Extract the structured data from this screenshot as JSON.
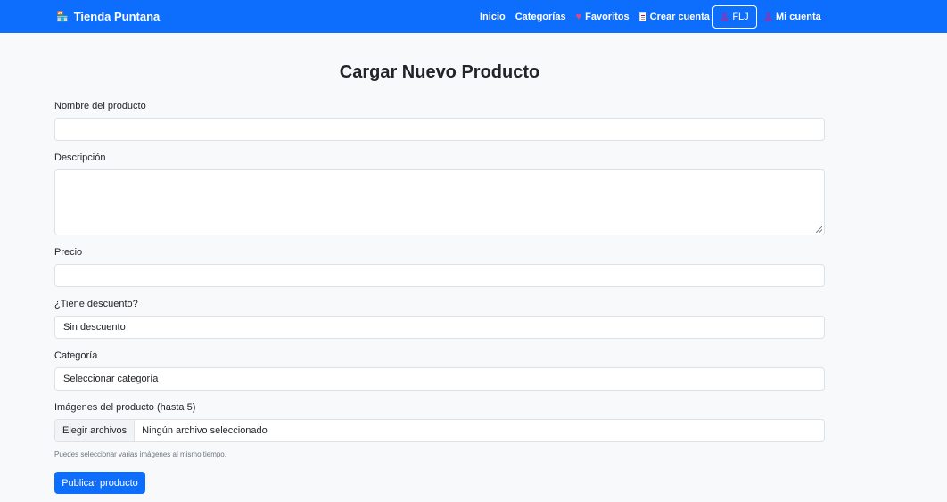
{
  "navbar": {
    "brand": "Tienda Puntana",
    "brand_icon": "store-icon",
    "links": {
      "home": "Inicio",
      "categories": "Categorías",
      "favorites": "Favoritos",
      "create_account": "Crear cuenta",
      "my_account": "Mi cuenta"
    },
    "user_initials": "FLJ",
    "color": "#0d6efd"
  },
  "page": {
    "title": "Cargar Nuevo Producto"
  },
  "form": {
    "name": {
      "label": "Nombre del producto",
      "value": ""
    },
    "description": {
      "label": "Descripción",
      "value": ""
    },
    "price": {
      "label": "Precio",
      "value": ""
    },
    "discount": {
      "label": "¿Tiene descuento?",
      "selected": "Sin descuento"
    },
    "category": {
      "label": "Categoría",
      "selected": "Seleccionar categoría"
    },
    "images": {
      "label": "Imágenes del producto (hasta 5)",
      "button_label": "Elegir archivos",
      "status": "Ningún archivo seleccionado",
      "help": "Puedes seleccionar varias imágenes al mismo tiempo."
    },
    "submit_label": "Publicar producto"
  }
}
